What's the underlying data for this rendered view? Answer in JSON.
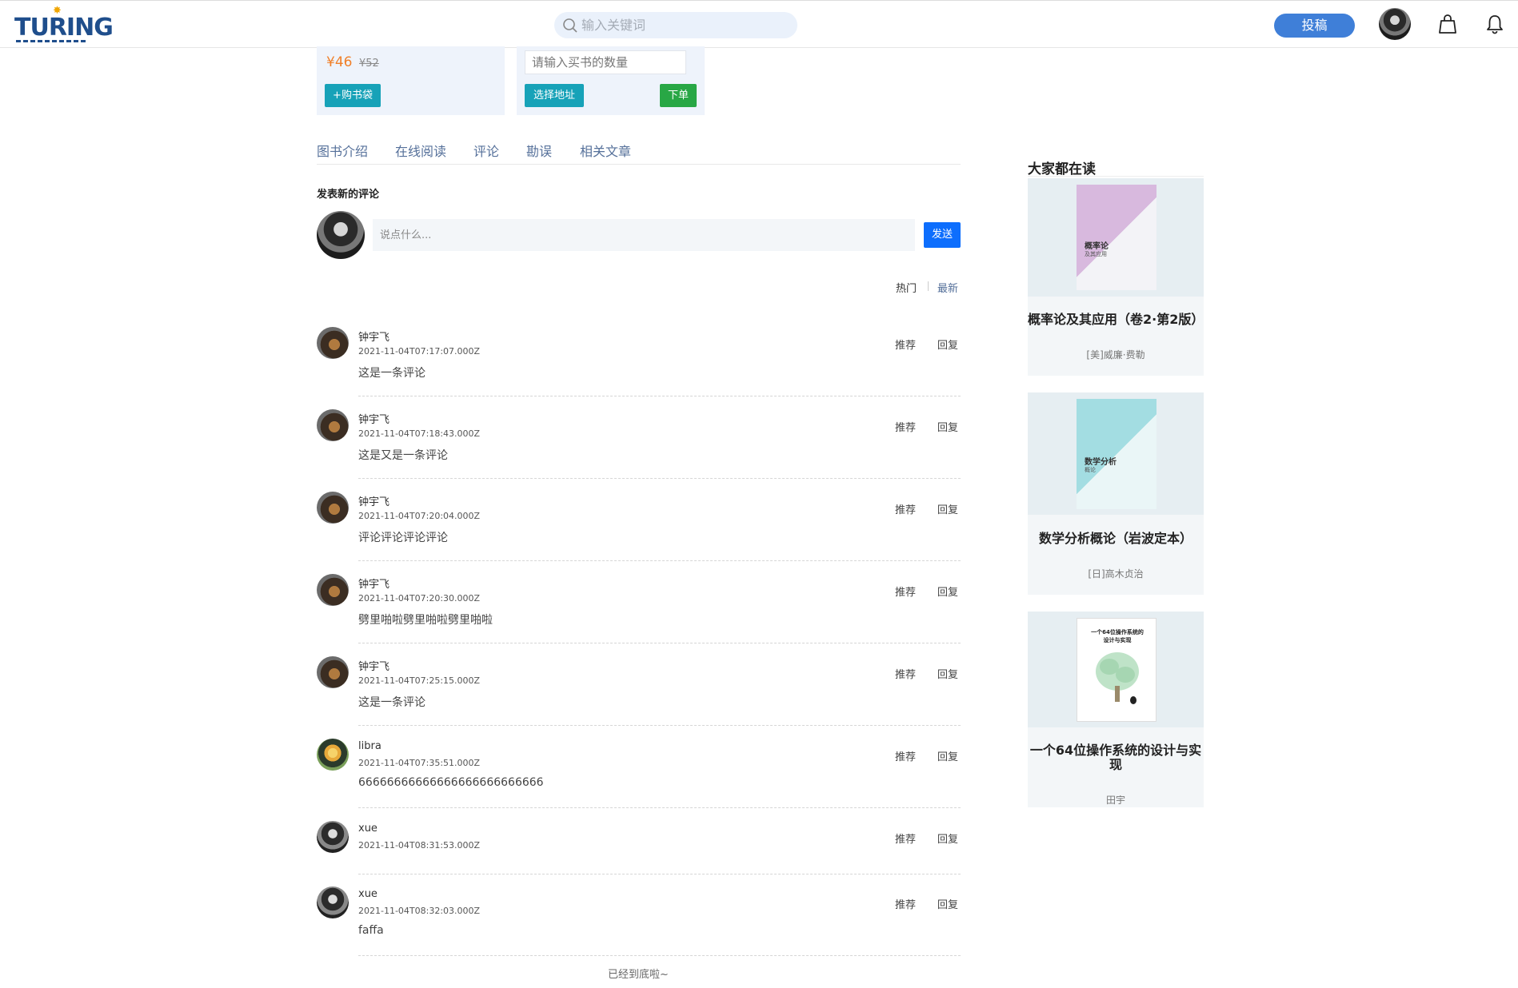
{
  "header": {
    "logo_text": "TURING",
    "search_placeholder": "输入关键词",
    "submit_label": "投稿"
  },
  "purchase": {
    "price_now": "¥46",
    "price_old": "¥52",
    "add_to_bag": "+购书袋",
    "qty_placeholder": "请输入买书的数量",
    "select_address": "选择地址",
    "place_order": "下单"
  },
  "tabs": [
    "图书介绍",
    "在线阅读",
    "评论",
    "勘误",
    "相关文章"
  ],
  "new_comment": {
    "title": "发表新的评论",
    "placeholder": "说点什么...",
    "send_label": "发送"
  },
  "sort": {
    "hot": "热门",
    "newest": "最新"
  },
  "comments": [
    {
      "user": "钟宇飞",
      "time": "2021-11-04T07:17:07.000Z",
      "text": "这是一条评论",
      "avatar": "a"
    },
    {
      "user": "钟宇飞",
      "time": "2021-11-04T07:18:43.000Z",
      "text": "这是又是一条评论",
      "avatar": "a"
    },
    {
      "user": "钟宇飞",
      "time": "2021-11-04T07:20:04.000Z",
      "text": "评论评论评论评论",
      "avatar": "a"
    },
    {
      "user": "钟宇飞",
      "time": "2021-11-04T07:20:30.000Z",
      "text": "劈里啪啦劈里啪啦劈里啪啦",
      "avatar": "a"
    },
    {
      "user": "钟宇飞",
      "time": "2021-11-04T07:25:15.000Z",
      "text": "这是一条评论",
      "avatar": "a"
    },
    {
      "user": "libra",
      "time": "2021-11-04T07:35:51.000Z",
      "text": "66666666666666666666666666",
      "avatar": "b"
    },
    {
      "user": "xue",
      "time": "2021-11-04T08:31:53.000Z",
      "text": "",
      "avatar": "c"
    },
    {
      "user": "xue",
      "time": "2021-11-04T08:32:03.000Z",
      "text": "faffa",
      "avatar": "c"
    }
  ],
  "comment_actions": {
    "recommend": "推荐",
    "reply": "回复"
  },
  "end_text": "已经到底啦~",
  "sidebar": {
    "title": "大家都在读",
    "books": [
      {
        "title": "概率论及其应用（卷2·第2版）",
        "author": "[美]威廉·费勒",
        "cover_color": "#d8b9de",
        "cover_text": "概率论",
        "cover_sub": "及其应用"
      },
      {
        "title": "数学分析概论（岩波定本）",
        "author": "[日]高木贞治",
        "cover_color": "#a3dde2",
        "cover_text": "数学分析",
        "cover_sub": "概论"
      },
      {
        "title": "一个64位操作系统的设计与实现",
        "author": "田宇",
        "cover_color": "#ffffff",
        "cover_text": "一个64位操作系统的",
        "cover_sub": "设计与实现"
      }
    ]
  }
}
